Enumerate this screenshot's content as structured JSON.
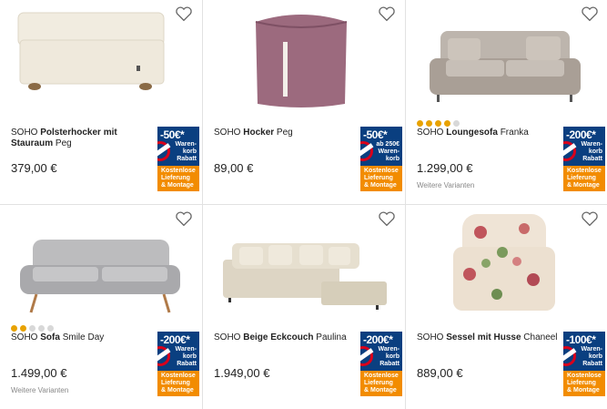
{
  "products": [
    {
      "brand": "SOHO",
      "name": "Polsterhocker mit Stauraum",
      "variant": "Peg",
      "price": "379,00 €",
      "discount": "-50€*",
      "discount_text": [
        "Waren-",
        "korb",
        "Rabatt"
      ],
      "delivery": [
        "Kostenlose",
        "Lieferung",
        "& Montage"
      ],
      "rating": 0,
      "more": ""
    },
    {
      "brand": "SOHO",
      "name": "Hocker",
      "variant": "Peg",
      "price": "89,00 €",
      "discount": "-50€*",
      "discount_text": [
        "ab 250€",
        "Waren-",
        "korb"
      ],
      "delivery": [
        "Kostenlose",
        "Lieferung",
        "& Montage"
      ],
      "rating": 0,
      "more": ""
    },
    {
      "brand": "SOHO",
      "name": "Loungesofa",
      "variant": "Franka",
      "price": "1.299,00 €",
      "discount": "-200€*",
      "discount_text": [
        "Waren-",
        "korb",
        "Rabatt"
      ],
      "delivery": [
        "Kostenlose",
        "Lieferung",
        "& Montage"
      ],
      "rating": 4,
      "more": "Weitere Varianten"
    },
    {
      "brand": "SOHO",
      "name": "Sofa",
      "variant": "Smile Day",
      "price": "1.499,00 €",
      "discount": "-200€*",
      "discount_text": [
        "Waren-",
        "korb",
        "Rabatt"
      ],
      "delivery": [
        "Kostenlose",
        "Lieferung",
        "& Montage"
      ],
      "rating": 2.5,
      "more": "Weitere Varianten"
    },
    {
      "brand": "SOHO",
      "name": "Beige Eckcouch",
      "variant": "Paulina",
      "price": "1.949,00 €",
      "discount": "-200€*",
      "discount_text": [
        "Waren-",
        "korb",
        "Rabatt"
      ],
      "delivery": [
        "Kostenlose",
        "Lieferung",
        "& Montage"
      ],
      "rating": 0,
      "more": ""
    },
    {
      "brand": "SOHO",
      "name": "Sessel mit Husse",
      "variant": "Chaneel",
      "price": "889,00 €",
      "discount": "-100€*",
      "discount_text": [
        "Waren-",
        "korb",
        "Rabatt"
      ],
      "delivery": [
        "Kostenlose",
        "Lieferung",
        "& Montage"
      ],
      "rating": 0,
      "more": ""
    }
  ],
  "icons": {
    "favorite": "heart-outline-icon"
  },
  "colors": {
    "badge_blue": "#0a3f80",
    "badge_orange": "#f28c00",
    "star": "#e8a200"
  }
}
